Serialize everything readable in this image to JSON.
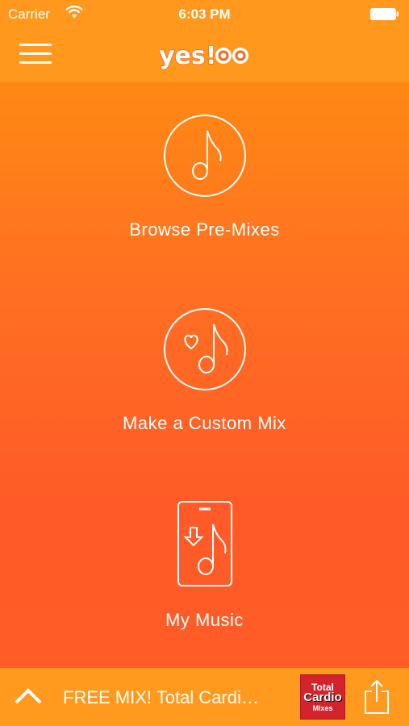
{
  "status_bar": {
    "carrier": "Carrier",
    "time": "6:03 PM"
  },
  "nav": {
    "logo_text": "yes!co",
    "menu_icon": "hamburger-menu-icon"
  },
  "actions": [
    {
      "label": "Browse Pre-Mixes",
      "icon": "music-note-circle-icon"
    },
    {
      "label": "Make a Custom Mix",
      "icon": "heart-music-note-circle-icon"
    },
    {
      "label": "My Music",
      "icon": "phone-download-music-icon"
    }
  ],
  "bottom_bar": {
    "promo_text": "FREE MIX! Total Cardi…",
    "album_art": {
      "line1": "Total",
      "line2": "Cardio",
      "line3": "Mixes"
    },
    "expand_icon": "chevron-up-icon",
    "share_icon": "share-icon"
  },
  "colors": {
    "top_bar": "#ff981c",
    "gradient_top": "#ff930e",
    "gradient_bottom": "#ff5d27",
    "bottom_bar": "#ff9a1f",
    "text": "#ffffff"
  }
}
